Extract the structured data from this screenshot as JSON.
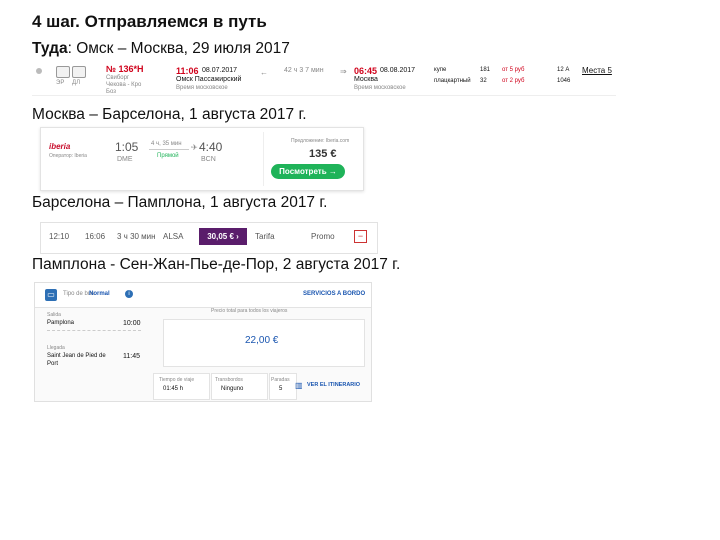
{
  "slide": {
    "title": "4 шаг. Отправляемся в путь",
    "leg1_label": "Туда",
    "leg1_rest": ": Омск – Москва, 29 июля 2017",
    "leg2": "Москва – Барселона, 1 августа 2017 г.",
    "leg3": "Барселона – Памплона, 1 августа 2017 г.",
    "leg4": "Памплона - Сен-Жан-Пье-де-Пор, 2 августа 2017 г."
  },
  "train": {
    "icon_1": "ЭР",
    "icon_2": "ДЛ",
    "number": "№ 136*Н",
    "sub1": "Свиборг",
    "sub2": "Чекова - Кро",
    "sub3": "Боз",
    "dep_time": "11:06",
    "dep_date": "08.07.2017",
    "dep_station": "Омск Пассажирский",
    "dep_tz": "Время московское",
    "duration": "42 ч 3 7 мин",
    "arr_time": "06:45",
    "arr_date": "08.08.2017",
    "arr_station": "Москва",
    "arr_tz": "Время московское",
    "class1": "купе",
    "class2": "плацкартный",
    "seats1": "181",
    "seats2": "32",
    "price1": "от 5 руб",
    "price2": "от 2 руб",
    "extra1": "12 А",
    "extra2": "1046",
    "link": "Места 5"
  },
  "flight": {
    "airline": "iberia",
    "airline_sub": "Оператор: Iberia",
    "dep_time": "1:05",
    "dep_code": "DME",
    "mid_top": "4 ч, 35 мин",
    "mid_bottom": "Прямой",
    "arr_time": "4:40",
    "arr_code": "BCN",
    "offer_label": "Предложение: Iberia.com",
    "price": "135 €",
    "button": "Посмотреть →"
  },
  "bus1": {
    "dep": "12:10",
    "arr": "16:06",
    "duration": "3 ч 30 мин",
    "carrier": "ALSA",
    "price": "30,05 € ›",
    "fare": "Tarifa",
    "info": "Promo"
  },
  "bus2": {
    "header_label": "Tipo de bus:",
    "header_value": "Normal",
    "header_link": "SERVICIOS A BORDO",
    "salida_label": "Salida",
    "salida_place": "Pamplona",
    "salida_time": "10:00",
    "llegada_label": "Llegada",
    "llegada_place1": "Saint Jean de Pied de",
    "llegada_place2": "Port",
    "llegada_time": "11:45",
    "price_note": "Precio total para todos los viajeros",
    "price": "22,00 €",
    "stat1_label": "Tiempo de viaje",
    "stat1_value": "01:45 h",
    "stat2_label": "Transbordos",
    "stat2_value": "Ninguno",
    "stat3_label": "Paradas",
    "stat3_value": "5",
    "itinerary": "VER EL ITINERARIO"
  }
}
